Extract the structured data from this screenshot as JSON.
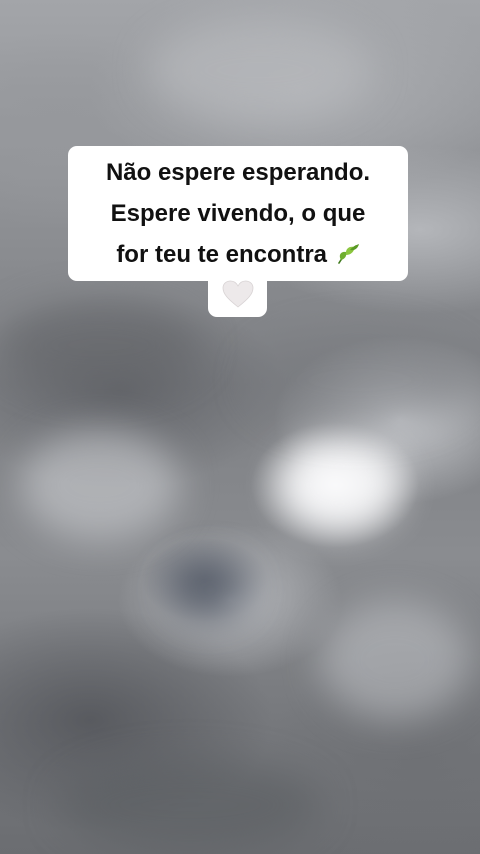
{
  "caption": {
    "lines": [
      "Não espere esperando.",
      "Espere vivendo, o que",
      "for teu te encontra"
    ]
  },
  "icons": {
    "leaf": "leaf-icon",
    "heart": "white-heart-icon"
  },
  "colors": {
    "caption_background": "#ffffff",
    "caption_text": "#111111",
    "leaf_green": "#6fae2f",
    "heart_fill": "#ede9ea"
  }
}
